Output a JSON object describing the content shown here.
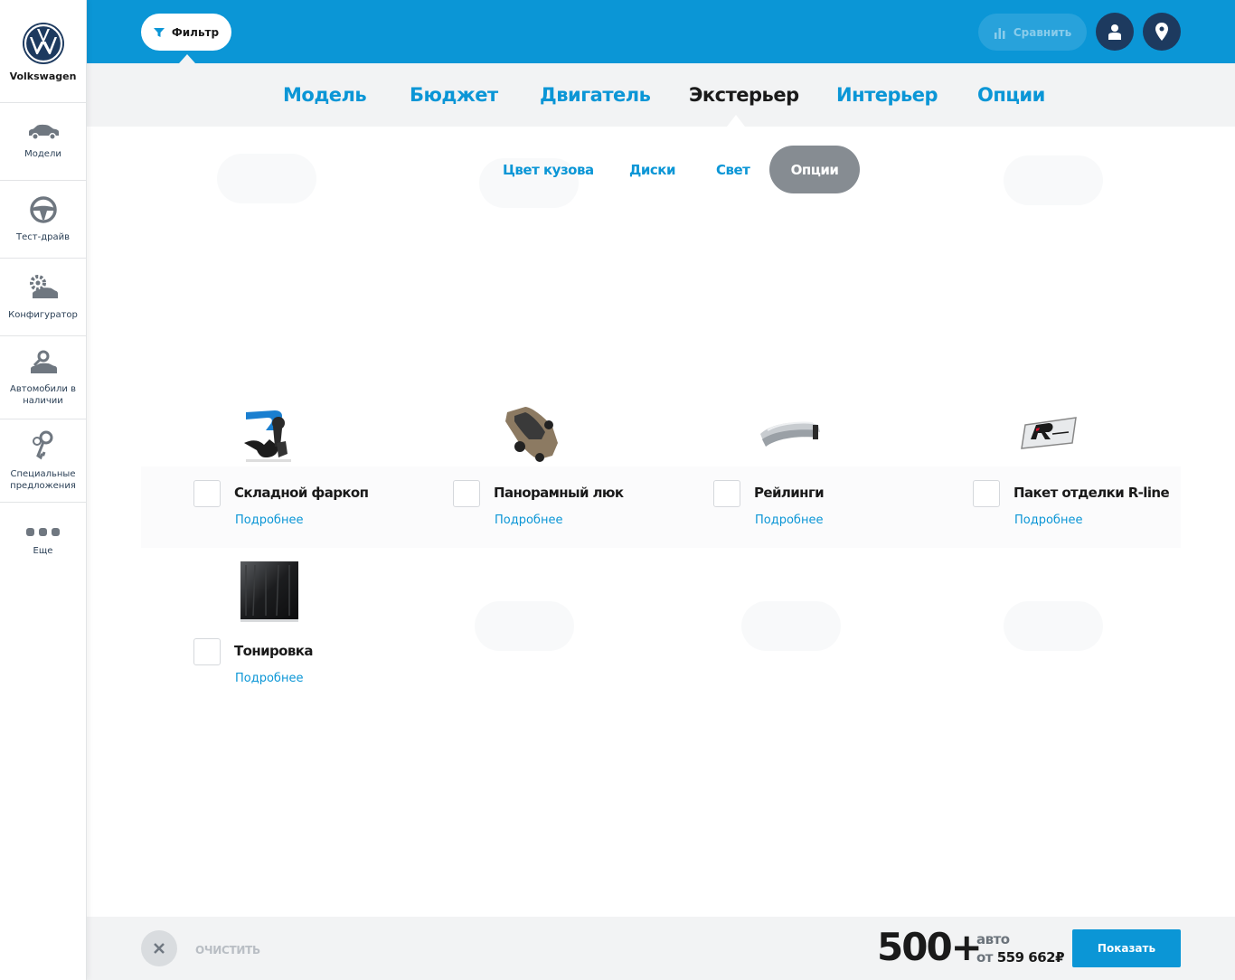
{
  "sidebar": {
    "brand": "Volkswagen",
    "items": [
      {
        "label": "Модели",
        "icon": "car-icon"
      },
      {
        "label": "Тест-драйв",
        "icon": "steering-wheel-icon"
      },
      {
        "label": "Конфигуратор",
        "icon": "configurator-icon"
      },
      {
        "label": "Автомобили в наличии",
        "icon": "car-search-icon"
      },
      {
        "label": "Специальные предложения",
        "icon": "keys-icon"
      },
      {
        "label": "Еще",
        "icon": "more-dots-icon"
      }
    ]
  },
  "topbar": {
    "filter_label": "Фильтр",
    "compare_label": "Сравнить"
  },
  "main_tabs": [
    "Модель",
    "Бюджет",
    "Двигатель",
    "Экстерьер",
    "Интерьер",
    "Опции"
  ],
  "active_main_tab": "Экстерьер",
  "sub_tabs": [
    "Цвет кузова",
    "Диски",
    "Свет",
    "Опции"
  ],
  "active_sub_tab": "Опции",
  "options": [
    {
      "title": "Складной фаркоп",
      "more": "Подробнее"
    },
    {
      "title": "Панорамный люк",
      "more": "Подробнее"
    },
    {
      "title": "Рейлинги",
      "more": "Подробнее"
    },
    {
      "title": "Пакет отделки R-line",
      "more": "Подробнее"
    },
    {
      "title": "Тонировка",
      "more": "Подробнее"
    }
  ],
  "footer": {
    "clear_label": "ОЧИСТИТЬ",
    "count": "500+",
    "unit": "авто",
    "from_prefix": "от",
    "price": "559 662₽",
    "show_label": "Показать"
  },
  "colors": {
    "accent": "#0b96d6",
    "dark": "#1d3a5f",
    "muted": "#868c92"
  }
}
